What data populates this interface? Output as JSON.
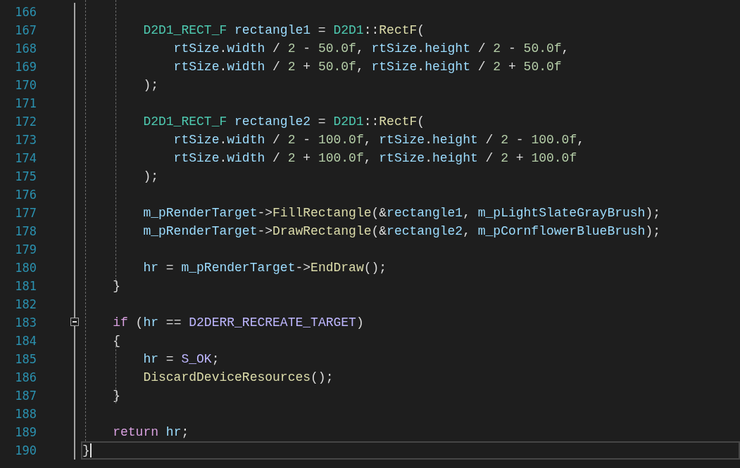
{
  "editor": {
    "lines": [
      {
        "number": "166",
        "foldable": false,
        "current": false
      },
      {
        "number": "167",
        "foldable": false,
        "current": false,
        "tokens": [
          {
            "text": "        D2D1_RECT_F",
            "kind": "type"
          },
          {
            "text": " rectangle1",
            "kind": "var"
          },
          {
            "text": " = ",
            "kind": "plain"
          },
          {
            "text": "D2D1",
            "kind": "type"
          },
          {
            "text": "::",
            "kind": "plain"
          },
          {
            "text": "RectF",
            "kind": "func"
          },
          {
            "text": "(",
            "kind": "plain"
          }
        ]
      },
      {
        "number": "168",
        "foldable": false,
        "current": false,
        "tokens": [
          {
            "text": "            rtSize",
            "kind": "var"
          },
          {
            "text": ".",
            "kind": "plain"
          },
          {
            "text": "width",
            "kind": "var"
          },
          {
            "text": " / ",
            "kind": "plain"
          },
          {
            "text": "2",
            "kind": "num"
          },
          {
            "text": " - ",
            "kind": "plain"
          },
          {
            "text": "50.0f",
            "kind": "num"
          },
          {
            "text": ", ",
            "kind": "plain"
          },
          {
            "text": "rtSize",
            "kind": "var"
          },
          {
            "text": ".",
            "kind": "plain"
          },
          {
            "text": "height",
            "kind": "var"
          },
          {
            "text": " / ",
            "kind": "plain"
          },
          {
            "text": "2",
            "kind": "num"
          },
          {
            "text": " - ",
            "kind": "plain"
          },
          {
            "text": "50.0f",
            "kind": "num"
          },
          {
            "text": ",",
            "kind": "plain"
          }
        ]
      },
      {
        "number": "169",
        "foldable": false,
        "current": false,
        "tokens": [
          {
            "text": "            rtSize",
            "kind": "var"
          },
          {
            "text": ".",
            "kind": "plain"
          },
          {
            "text": "width",
            "kind": "var"
          },
          {
            "text": " / ",
            "kind": "plain"
          },
          {
            "text": "2",
            "kind": "num"
          },
          {
            "text": " + ",
            "kind": "plain"
          },
          {
            "text": "50.0f",
            "kind": "num"
          },
          {
            "text": ", ",
            "kind": "plain"
          },
          {
            "text": "rtSize",
            "kind": "var"
          },
          {
            "text": ".",
            "kind": "plain"
          },
          {
            "text": "height",
            "kind": "var"
          },
          {
            "text": " / ",
            "kind": "plain"
          },
          {
            "text": "2",
            "kind": "num"
          },
          {
            "text": " + ",
            "kind": "plain"
          },
          {
            "text": "50.0f",
            "kind": "num"
          }
        ]
      },
      {
        "number": "170",
        "foldable": false,
        "current": false,
        "tokens": [
          {
            "text": "        );",
            "kind": "plain"
          }
        ]
      },
      {
        "number": "171",
        "foldable": false,
        "current": false
      },
      {
        "number": "172",
        "foldable": false,
        "current": false,
        "tokens": [
          {
            "text": "        D2D1_RECT_F",
            "kind": "type"
          },
          {
            "text": " rectangle2",
            "kind": "var"
          },
          {
            "text": " = ",
            "kind": "plain"
          },
          {
            "text": "D2D1",
            "kind": "type"
          },
          {
            "text": "::",
            "kind": "plain"
          },
          {
            "text": "RectF",
            "kind": "func"
          },
          {
            "text": "(",
            "kind": "plain"
          }
        ]
      },
      {
        "number": "173",
        "foldable": false,
        "current": false,
        "tokens": [
          {
            "text": "            rtSize",
            "kind": "var"
          },
          {
            "text": ".",
            "kind": "plain"
          },
          {
            "text": "width",
            "kind": "var"
          },
          {
            "text": " / ",
            "kind": "plain"
          },
          {
            "text": "2",
            "kind": "num"
          },
          {
            "text": " - ",
            "kind": "plain"
          },
          {
            "text": "100.0f",
            "kind": "num"
          },
          {
            "text": ", ",
            "kind": "plain"
          },
          {
            "text": "rtSize",
            "kind": "var"
          },
          {
            "text": ".",
            "kind": "plain"
          },
          {
            "text": "height",
            "kind": "var"
          },
          {
            "text": " / ",
            "kind": "plain"
          },
          {
            "text": "2",
            "kind": "num"
          },
          {
            "text": " - ",
            "kind": "plain"
          },
          {
            "text": "100.0f",
            "kind": "num"
          },
          {
            "text": ",",
            "kind": "plain"
          }
        ]
      },
      {
        "number": "174",
        "foldable": false,
        "current": false,
        "tokens": [
          {
            "text": "            rtSize",
            "kind": "var"
          },
          {
            "text": ".",
            "kind": "plain"
          },
          {
            "text": "width",
            "kind": "var"
          },
          {
            "text": " / ",
            "kind": "plain"
          },
          {
            "text": "2",
            "kind": "num"
          },
          {
            "text": " + ",
            "kind": "plain"
          },
          {
            "text": "100.0f",
            "kind": "num"
          },
          {
            "text": ", ",
            "kind": "plain"
          },
          {
            "text": "rtSize",
            "kind": "var"
          },
          {
            "text": ".",
            "kind": "plain"
          },
          {
            "text": "height",
            "kind": "var"
          },
          {
            "text": " / ",
            "kind": "plain"
          },
          {
            "text": "2",
            "kind": "num"
          },
          {
            "text": " + ",
            "kind": "plain"
          },
          {
            "text": "100.0f",
            "kind": "num"
          }
        ]
      },
      {
        "number": "175",
        "foldable": false,
        "current": false,
        "tokens": [
          {
            "text": "        );",
            "kind": "plain"
          }
        ]
      },
      {
        "number": "176",
        "foldable": false,
        "current": false
      },
      {
        "number": "177",
        "foldable": false,
        "current": false,
        "tokens": [
          {
            "text": "        m_pRenderTarget",
            "kind": "var"
          },
          {
            "text": "->",
            "kind": "plain"
          },
          {
            "text": "FillRectangle",
            "kind": "func"
          },
          {
            "text": "(&",
            "kind": "plain"
          },
          {
            "text": "rectangle1",
            "kind": "var"
          },
          {
            "text": ", ",
            "kind": "plain"
          },
          {
            "text": "m_pLightSlateGrayBrush",
            "kind": "var"
          },
          {
            "text": ");",
            "kind": "plain"
          }
        ]
      },
      {
        "number": "178",
        "foldable": false,
        "current": false,
        "tokens": [
          {
            "text": "        m_pRenderTarget",
            "kind": "var"
          },
          {
            "text": "->",
            "kind": "plain"
          },
          {
            "text": "DrawRectangle",
            "kind": "func"
          },
          {
            "text": "(&",
            "kind": "plain"
          },
          {
            "text": "rectangle2",
            "kind": "var"
          },
          {
            "text": ", ",
            "kind": "plain"
          },
          {
            "text": "m_pCornflowerBlueBrush",
            "kind": "var"
          },
          {
            "text": ");",
            "kind": "plain"
          }
        ]
      },
      {
        "number": "179",
        "foldable": false,
        "current": false
      },
      {
        "number": "180",
        "foldable": false,
        "current": false,
        "tokens": [
          {
            "text": "        hr",
            "kind": "var"
          },
          {
            "text": " = ",
            "kind": "plain"
          },
          {
            "text": "m_pRenderTarget",
            "kind": "var"
          },
          {
            "text": "->",
            "kind": "plain"
          },
          {
            "text": "EndDraw",
            "kind": "func"
          },
          {
            "text": "();",
            "kind": "plain"
          }
        ]
      },
      {
        "number": "181",
        "foldable": false,
        "current": false,
        "tokens": [
          {
            "text": "    }",
            "kind": "plain"
          }
        ]
      },
      {
        "number": "182",
        "foldable": false,
        "current": false
      },
      {
        "number": "183",
        "foldable": true,
        "current": false,
        "tokens": [
          {
            "text": "    if",
            "kind": "keyword"
          },
          {
            "text": " (",
            "kind": "plain"
          },
          {
            "text": "hr",
            "kind": "var"
          },
          {
            "text": " == ",
            "kind": "plain"
          },
          {
            "text": "D2DERR_RECREATE_TARGET",
            "kind": "macro"
          },
          {
            "text": ")",
            "kind": "plain"
          }
        ]
      },
      {
        "number": "184",
        "foldable": false,
        "current": false,
        "tokens": [
          {
            "text": "    {",
            "kind": "plain"
          }
        ]
      },
      {
        "number": "185",
        "foldable": false,
        "current": false,
        "tokens": [
          {
            "text": "        hr",
            "kind": "var"
          },
          {
            "text": " = ",
            "kind": "plain"
          },
          {
            "text": "S_OK",
            "kind": "macro"
          },
          {
            "text": ";",
            "kind": "plain"
          }
        ]
      },
      {
        "number": "186",
        "foldable": false,
        "current": false,
        "tokens": [
          {
            "text": "        DiscardDeviceResources",
            "kind": "func"
          },
          {
            "text": "();",
            "kind": "plain"
          }
        ]
      },
      {
        "number": "187",
        "foldable": false,
        "current": false,
        "tokens": [
          {
            "text": "    }",
            "kind": "plain"
          }
        ]
      },
      {
        "number": "188",
        "foldable": false,
        "current": false
      },
      {
        "number": "189",
        "foldable": false,
        "current": false,
        "tokens": [
          {
            "text": "    return",
            "kind": "keyword"
          },
          {
            "text": " hr",
            "kind": "var"
          },
          {
            "text": ";",
            "kind": "plain"
          }
        ]
      },
      {
        "number": "190",
        "foldable": false,
        "current": true,
        "tokens": [
          {
            "text": "}",
            "kind": "plain"
          }
        ]
      }
    ]
  }
}
